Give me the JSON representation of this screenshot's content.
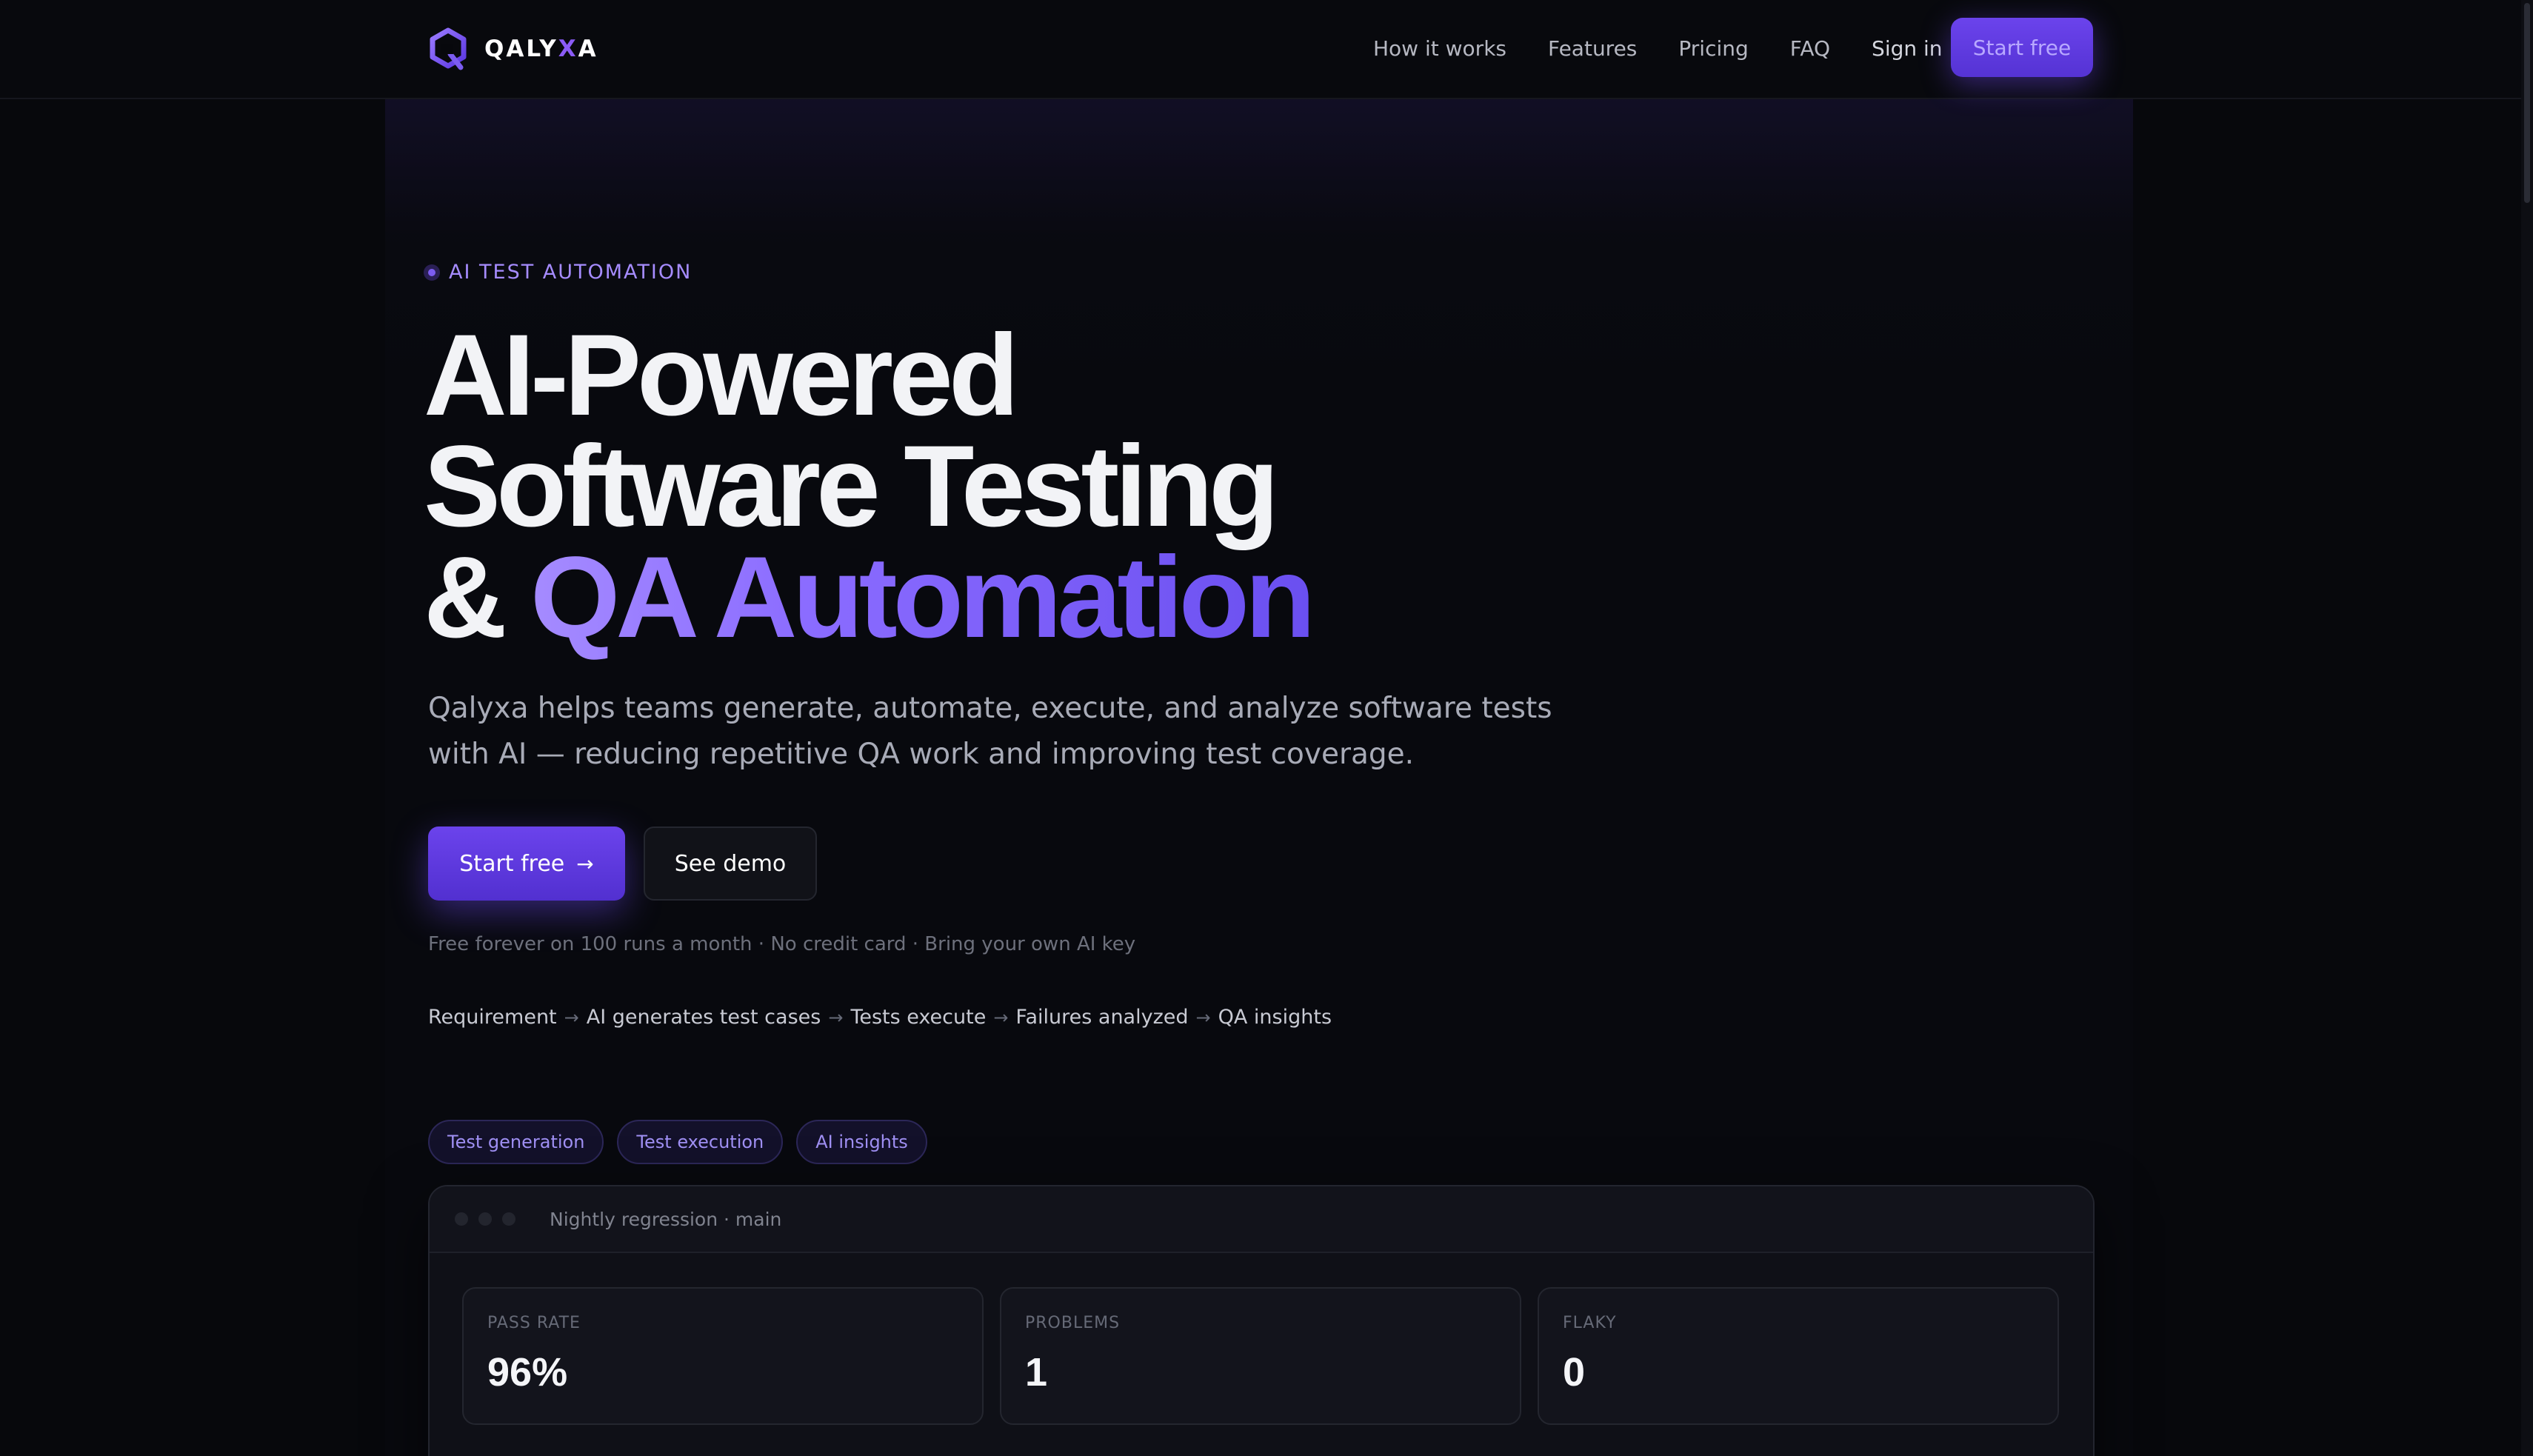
{
  "brand": {
    "name_prefix": "QALY",
    "name_accent": "X",
    "name_suffix": "A",
    "accent_color": "#8b5cf6"
  },
  "nav": {
    "links": [
      "How it works",
      "Features",
      "Pricing",
      "FAQ",
      "Sign in"
    ],
    "cta_label": "Start free"
  },
  "hero": {
    "eyebrow": "AI TEST AUTOMATION",
    "headline_line1": "AI-Powered",
    "headline_line2": "Software Testing",
    "headline_line3_plain": "& ",
    "headline_line3_accent": "QA Automation",
    "subtext": "Qalyxa helps teams generate, automate, execute, and analyze software tests with AI — reducing repetitive QA work and improving test coverage.",
    "primary_button": "Start free",
    "primary_button_icon": "arrow-right-icon",
    "secondary_button": "See demo",
    "fineprint": "Free forever on 100 runs a month · No credit card · Bring your own AI key",
    "flow_steps": [
      "Requirement",
      "AI generates test cases",
      "Tests execute",
      "Failures analyzed",
      "QA insights"
    ]
  },
  "tabs": [
    "Test generation",
    "Test execution",
    "AI insights"
  ],
  "dashboard": {
    "title": "Nightly regression · main",
    "stats": [
      {
        "label": "PASS RATE",
        "value": "96%"
      },
      {
        "label": "PROBLEMS",
        "value": "1"
      },
      {
        "label": "FLAKY",
        "value": "0"
      }
    ]
  },
  "colors": {
    "background": "#07080c",
    "primary": "#6b43ec",
    "eyebrow": "#a68cff"
  }
}
